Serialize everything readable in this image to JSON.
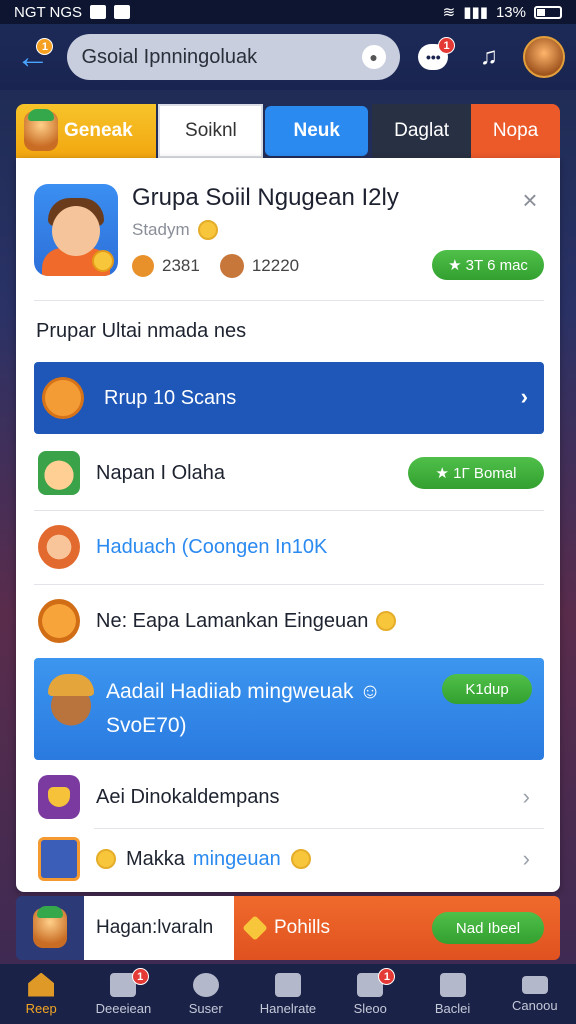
{
  "status": {
    "carrier": "NGT NGS",
    "battery": "13%"
  },
  "appbar": {
    "back_badge": "1",
    "search_value": "Gsoial Ipnningoluak",
    "chat_badge": "1"
  },
  "tabs": [
    {
      "label": "Geneak"
    },
    {
      "label": "Soiknl"
    },
    {
      "label": "Neuk"
    },
    {
      "label": "Daglat"
    },
    {
      "label": "Nopa"
    }
  ],
  "header": {
    "title": "Grupa Soiil Ngugean I2ly",
    "subtitle": "Stadym",
    "stat1": "2381",
    "stat2": "12220",
    "button": "★ 3T 6 mac",
    "close": "×"
  },
  "section_label": "Prupar Ultai nmada nes",
  "rows": {
    "blue_row": {
      "label": "Rrup 10 Scans",
      "chev": "›"
    },
    "row1": {
      "label": "Napan I Olaha",
      "button": "★ 1Γ Bomal"
    },
    "row2": {
      "label": "Haduach (Coongen In10K"
    },
    "row3": {
      "label": "Ne: Eapa Lamankan Eingeuan"
    },
    "feature": {
      "line1": "Aadail Hadiiab mingweuak ☺",
      "line2": "SvoE70)",
      "button": "K1dup"
    },
    "row4": {
      "label": "Aei Dinokaldempans",
      "chev": "›"
    },
    "row5": {
      "label_a": "Makka",
      "label_b": "mingeuan",
      "chev": "›"
    }
  },
  "promo": {
    "left_label": "Hagan:lvaraln",
    "mid_label": "Pohills",
    "button": "Nad Ibeel"
  },
  "bottom_nav": [
    {
      "label": "Reep",
      "badge": ""
    },
    {
      "label": "Deeeiean",
      "badge": "1"
    },
    {
      "label": "Suser",
      "badge": ""
    },
    {
      "label": "Hanelrate",
      "badge": ""
    },
    {
      "label": "Sleoo",
      "badge": "1"
    },
    {
      "label": "Baclei",
      "badge": ""
    },
    {
      "label": "Canoou",
      "badge": ""
    }
  ],
  "colors": {
    "accent_blue": "#2b8af0",
    "deep_blue": "#1e57b8",
    "green": "#33a02f",
    "orange": "#ec5a2a",
    "yellow": "#f2a60f"
  }
}
